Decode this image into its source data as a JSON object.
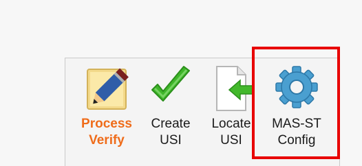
{
  "toolbar": {
    "items": [
      {
        "id": "process-verify",
        "line1": "Process",
        "line2": "Verify",
        "icon": "pencil-icon",
        "active": true
      },
      {
        "id": "create-usi",
        "line1": "Create",
        "line2": "USI",
        "icon": "checkmark-icon",
        "active": false
      },
      {
        "id": "locate-usi",
        "line1": "Locate",
        "line2": "USI",
        "icon": "document-arrow-icon",
        "active": false
      },
      {
        "id": "mas-st-config",
        "line1": "MAS-ST",
        "line2": "Config",
        "icon": "gear-icon",
        "active": false
      }
    ]
  },
  "colors": {
    "active_label": "#ef6c1a",
    "highlight": "#e80000",
    "checkmark": "#3fb62a",
    "gear": "#4a9fd0"
  }
}
